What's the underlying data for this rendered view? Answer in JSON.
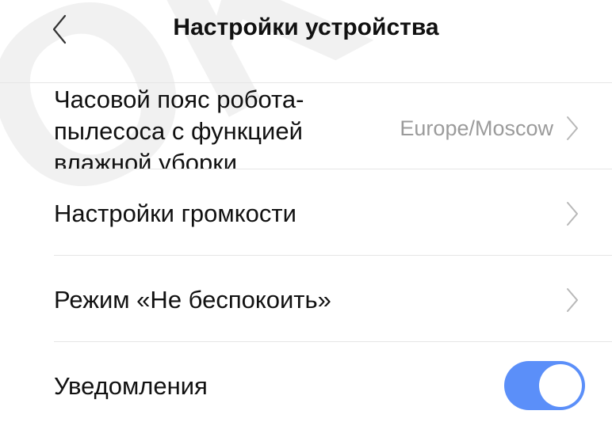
{
  "header": {
    "title": "Настройки устройства",
    "back_icon": "chevron-left-icon"
  },
  "watermark": {
    "text": "OK"
  },
  "rows": {
    "timezone": {
      "label": "Часовой пояс робота-пылесоса с функцией влажной уборки",
      "value": "Europe/Moscow",
      "icon": "chevron-right-icon"
    },
    "volume": {
      "label": "Настройки громкости",
      "icon": "chevron-right-icon"
    },
    "dnd": {
      "label": "Режим «Не беспокоить»",
      "icon": "chevron-right-icon"
    },
    "notifications": {
      "label": "Уведомления",
      "enabled": true
    }
  },
  "colors": {
    "accent": "#5b8ff9",
    "text": "#111111",
    "secondary_text": "#9b9b9b",
    "divider": "#e6e6e6",
    "chevron": "#b8b8b8"
  }
}
